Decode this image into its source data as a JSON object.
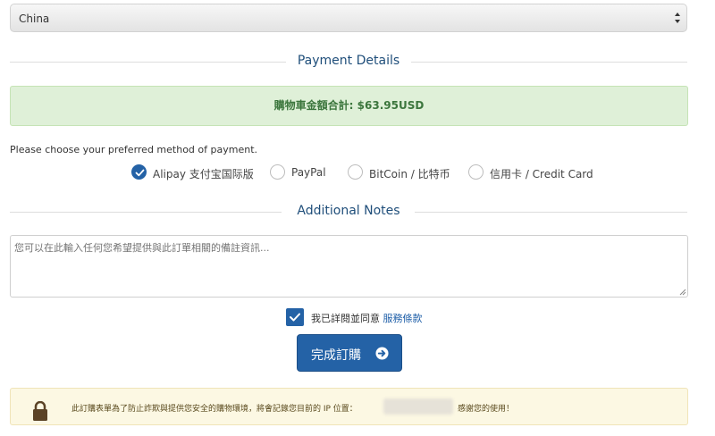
{
  "country_select": {
    "value": "China"
  },
  "payment_section": {
    "title": "Payment Details"
  },
  "total": {
    "label": "購物車金額合計:",
    "amount": "$63.95USD"
  },
  "payment": {
    "prompt": "Please choose your preferred method of payment.",
    "options": [
      {
        "label": "Alipay 支付宝国际版",
        "selected": true
      },
      {
        "label": "PayPal",
        "selected": false
      },
      {
        "label": "BitCoin / 比特币",
        "selected": false
      },
      {
        "label": "信用卡 / Credit Card",
        "selected": false
      }
    ]
  },
  "notes_section": {
    "title": "Additional Notes",
    "placeholder": "您可以在此輸入任何您希望提供與此訂單相關的備註資訊..."
  },
  "agreement": {
    "text": "我已詳閱並同意",
    "link": "服務條款",
    "checked": true
  },
  "submit": {
    "label": "完成訂購"
  },
  "notice": {
    "text": "此訂購表單為了防止詐欺與提供您安全的購物環境，將會記錄您目前的 IP 位置：",
    "thanks": "感謝您的使用！"
  },
  "colors": {
    "accent": "#2462a6",
    "success_bg": "#dff0d8",
    "success_text": "#3c763d",
    "notice_bg": "#fcf8e3"
  },
  "icons": [
    "select-arrows-icon",
    "check-icon",
    "arrow-circle-right-icon",
    "lock-icon",
    "resize-grip-icon"
  ]
}
